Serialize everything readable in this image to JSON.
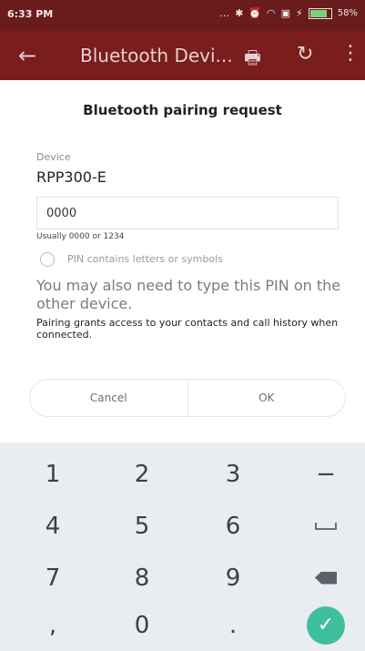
{
  "status_bar": {
    "time": "6:33 PM",
    "icons": [
      "ellipsis-icon",
      "bluetooth-icon",
      "alarm-icon",
      "wifi-icon",
      "sim-icon",
      "charging-icon",
      "battery-icon"
    ],
    "battery_text": "58%"
  },
  "app_bar": {
    "back_icon": "←",
    "title": "Bluetooth Devi...",
    "print_icon": "🖶",
    "refresh_icon": "↻",
    "more_icon": "⋮"
  },
  "dialog": {
    "title": "Bluetooth pairing request",
    "device_label": "Device",
    "device_name": "RPP300-E",
    "pin_value": "0000",
    "pin_hint": "Usually 0000 or 1234",
    "pin_option_label": "PIN contains letters or symbols",
    "info_text": "You may also need to type this PIN on the other device.",
    "access_text": "Pairing grants access to your contacts and call history when connected.",
    "cancel_label": "Cancel",
    "ok_label": "OK"
  },
  "keypad": {
    "keys": [
      "1",
      "2",
      "3",
      "−",
      "4",
      "5",
      "6",
      "␣",
      "7",
      "8",
      "9",
      "⌫",
      ",",
      "0",
      ".",
      "✓"
    ],
    "accent_color": "#3fbf9e"
  }
}
